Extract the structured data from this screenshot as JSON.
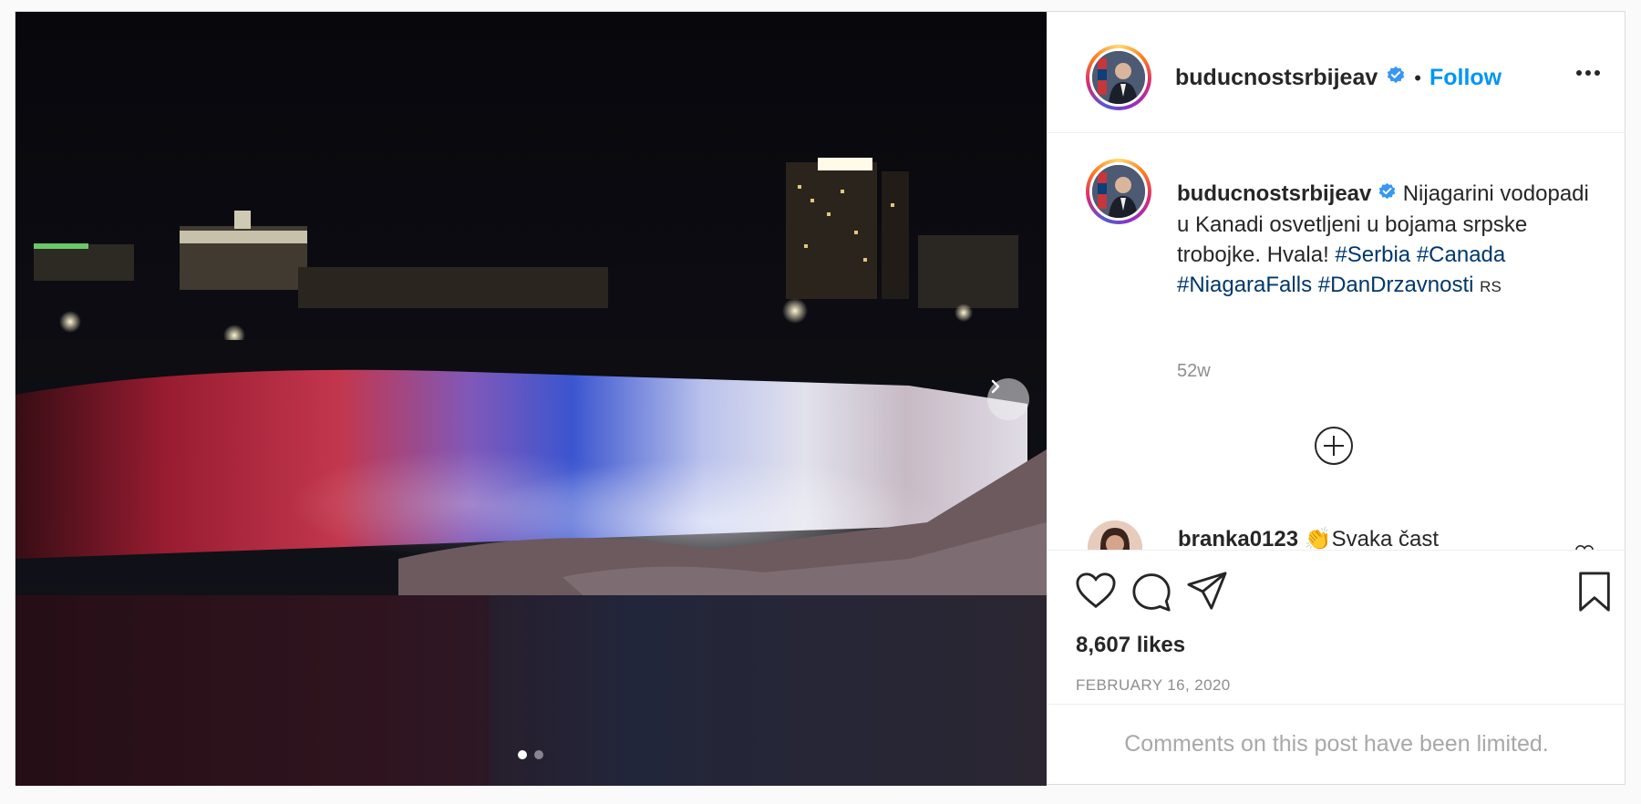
{
  "post": {
    "username": "buducnostsrbijeav",
    "follow_label": "Follow",
    "separator": "•",
    "caption_text": "Nijagarini vodopadi u Kanadi osvetljeni u bojama srpske trobojke. Hvala!",
    "hashtags": [
      "#Serbia",
      "#Canada",
      "#NiagaraFalls",
      "#DanDrzavnosti"
    ],
    "country_code": "RS",
    "time_ago": "52w",
    "likes": "8,607 likes",
    "date": "FEBRUARY 16, 2020",
    "comments_limited": "Comments on this post have been limited."
  },
  "comment": {
    "username": "branka0123",
    "text": "Svaka čast",
    "emoji": "👏"
  },
  "carousel": {
    "total": 2,
    "active_index": 0
  },
  "icons": {
    "verified": "verified-badge-icon",
    "more": "more-options-icon",
    "like": "heart-icon",
    "comment": "comment-bubble-icon",
    "share": "paper-plane-icon",
    "save": "bookmark-icon",
    "load_more": "plus-circle-icon",
    "next": "chevron-right-icon"
  },
  "colors": {
    "follow": "#0095f6",
    "hashtag": "#00376b",
    "verified": "#3897f0",
    "muted": "#8e8e8e"
  }
}
